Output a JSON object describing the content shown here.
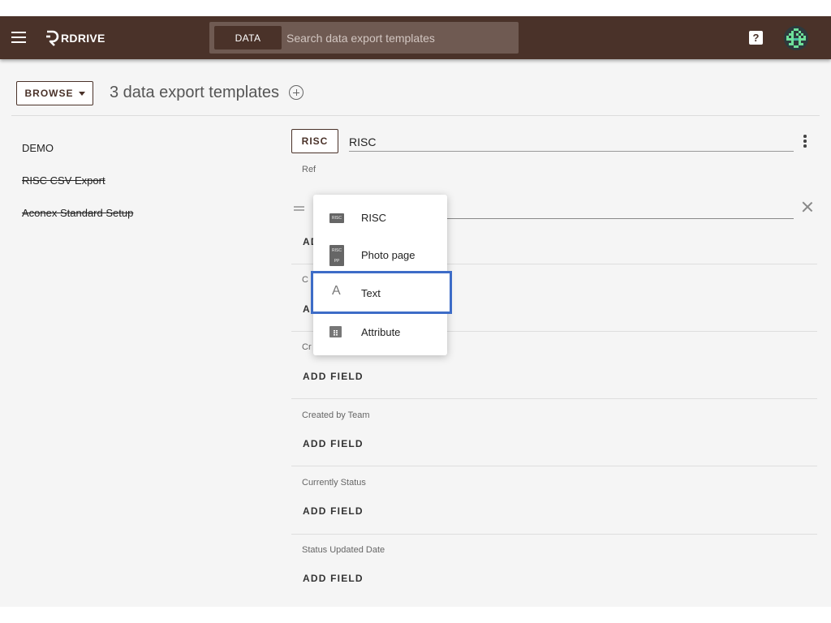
{
  "topbar": {
    "logo_text": "RDRIVE",
    "search_chip": "DATA",
    "search_placeholder": "Search data export templates",
    "help_label": "?"
  },
  "header": {
    "browse_label": "BROWSE",
    "title": "3 data export templates"
  },
  "sidebar": {
    "items": [
      {
        "label": "DEMO",
        "strikethrough": false
      },
      {
        "label": "RISC CSV Export",
        "strikethrough": true
      },
      {
        "label": "Aconex Standard Setup",
        "strikethrough": true
      }
    ]
  },
  "editor": {
    "chip_label": "RISC",
    "name_value": "RISC",
    "ref_label": "Ref",
    "add_field_label": "ADD FIELD",
    "sections": [
      {
        "label": "Created by Team"
      },
      {
        "label": "Currently Status"
      },
      {
        "label": "Status Updated Date"
      }
    ],
    "partial_labels": {
      "add_field_fragment": "AD",
      "section2_fragment": "C",
      "section2_add_fragment": "A",
      "section3_fragment": "Cr"
    }
  },
  "dropdown": {
    "items": [
      {
        "label": "RISC",
        "icon": "risc-document-icon",
        "badge_text": "RISC",
        "highlighted": false
      },
      {
        "label": "Photo page",
        "icon": "risc-photo-page-icon",
        "badge_text": "RISC",
        "badge_sub": "PP",
        "highlighted": false
      },
      {
        "label": "Text",
        "icon": "text-icon",
        "glyph": "A",
        "highlighted": true
      },
      {
        "label": "Attribute",
        "icon": "attribute-icon",
        "highlighted": false
      }
    ]
  },
  "colors": {
    "topbar": "#4a3229",
    "search_bg": "#6f5a52",
    "highlight_outline": "#3d6cc7",
    "page_bg": "#f5f5f5"
  }
}
